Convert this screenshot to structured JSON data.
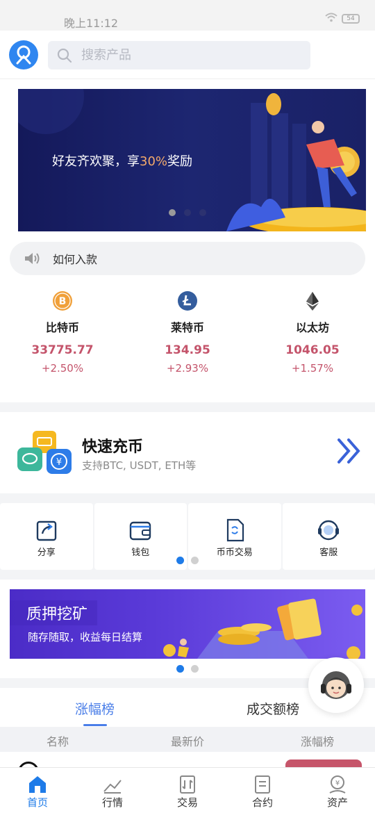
{
  "status": {
    "time": "晚上11:12",
    "battery": "54"
  },
  "search": {
    "placeholder": "搜索产品"
  },
  "banner": {
    "text_before": "好友齐欢聚，享",
    "text_highlight": "30%",
    "text_after": "奖励"
  },
  "notice": {
    "text": "如何入款"
  },
  "coins": [
    {
      "name": "比特币",
      "price": "33775.77",
      "change": "+2.50%",
      "icon": "bitcoin-icon",
      "color": "#f0a03a"
    },
    {
      "name": "莱特币",
      "price": "134.95",
      "change": "+2.93%",
      "icon": "litecoin-icon",
      "color": "#345d9d"
    },
    {
      "name": "以太坊",
      "price": "1046.05",
      "change": "+1.57%",
      "icon": "ethereum-icon",
      "color": "#333333"
    }
  ],
  "recharge": {
    "title": "快速充币",
    "subtitle": "支持BTC, USDT, ETH等"
  },
  "shortcuts": [
    {
      "label": "分享",
      "icon": "share-icon"
    },
    {
      "label": "钱包",
      "icon": "wallet-icon"
    },
    {
      "label": "币币交易",
      "icon": "coin-trade-icon"
    },
    {
      "label": "客服",
      "icon": "customer-service-icon"
    }
  ],
  "mining": {
    "title": "质押挖矿",
    "subtitle": "随存随取，收益每日结算"
  },
  "ranking": {
    "tabs": [
      "涨幅榜",
      "成交额榜"
    ],
    "active_tab": 0,
    "columns": [
      "名称",
      "最新价",
      "涨幅榜"
    ]
  },
  "nav": [
    {
      "label": "首页",
      "icon": "home-icon",
      "active": true
    },
    {
      "label": "行情",
      "icon": "market-icon",
      "active": false
    },
    {
      "label": "交易",
      "icon": "trade-icon",
      "active": false
    },
    {
      "label": "合约",
      "icon": "contract-icon",
      "active": false
    },
    {
      "label": "资产",
      "icon": "assets-icon",
      "active": false
    }
  ],
  "colors": {
    "accent": "#1e7be8",
    "up": "#c4546b",
    "banner_bg": "#1a2166",
    "mining_bg": "#5a3ad8"
  }
}
